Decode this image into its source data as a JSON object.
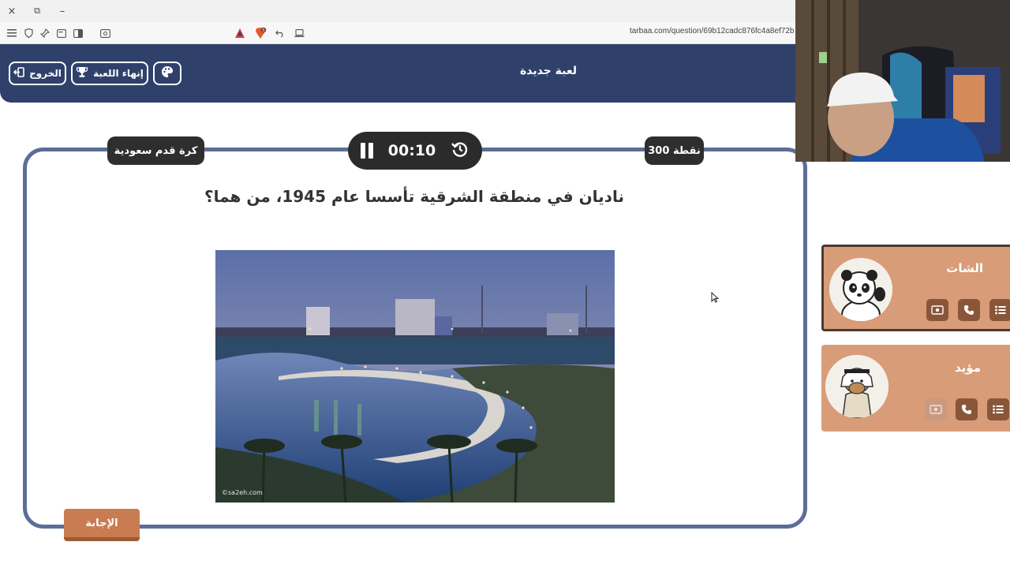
{
  "browser": {
    "close_icon": "×",
    "restore_icon": "⧉",
    "minimize_icon": "–",
    "url": "tarbaa.com/question/69b12cadc876fc4a8ef72b"
  },
  "header": {
    "title": "لعبة جديدة",
    "end_game_label": "إنهاء اللعبة",
    "exit_label": "الخروج",
    "palette_icon": "palette-icon",
    "trophy_icon": "trophy-icon",
    "exit_icon": "exit-icon"
  },
  "question_card": {
    "category": "كرة قدم سعودية",
    "points": "300 نقطة",
    "timer": "00:10",
    "question": "ناديان في منطقة الشرقية تأسسا عام 1945، من هما؟",
    "image_watermark": "©sa2eh.com",
    "answer_label": "الإجابة"
  },
  "players": [
    {
      "name": "الشات",
      "active": true
    },
    {
      "name": "مؤيد",
      "active": false
    }
  ],
  "colors": {
    "header_bg": "#2f416b",
    "card_border": "#5c6e98",
    "player_bg": "#d99c78",
    "player_btn": "#8a5639",
    "answer_btn": "#c97c51"
  }
}
